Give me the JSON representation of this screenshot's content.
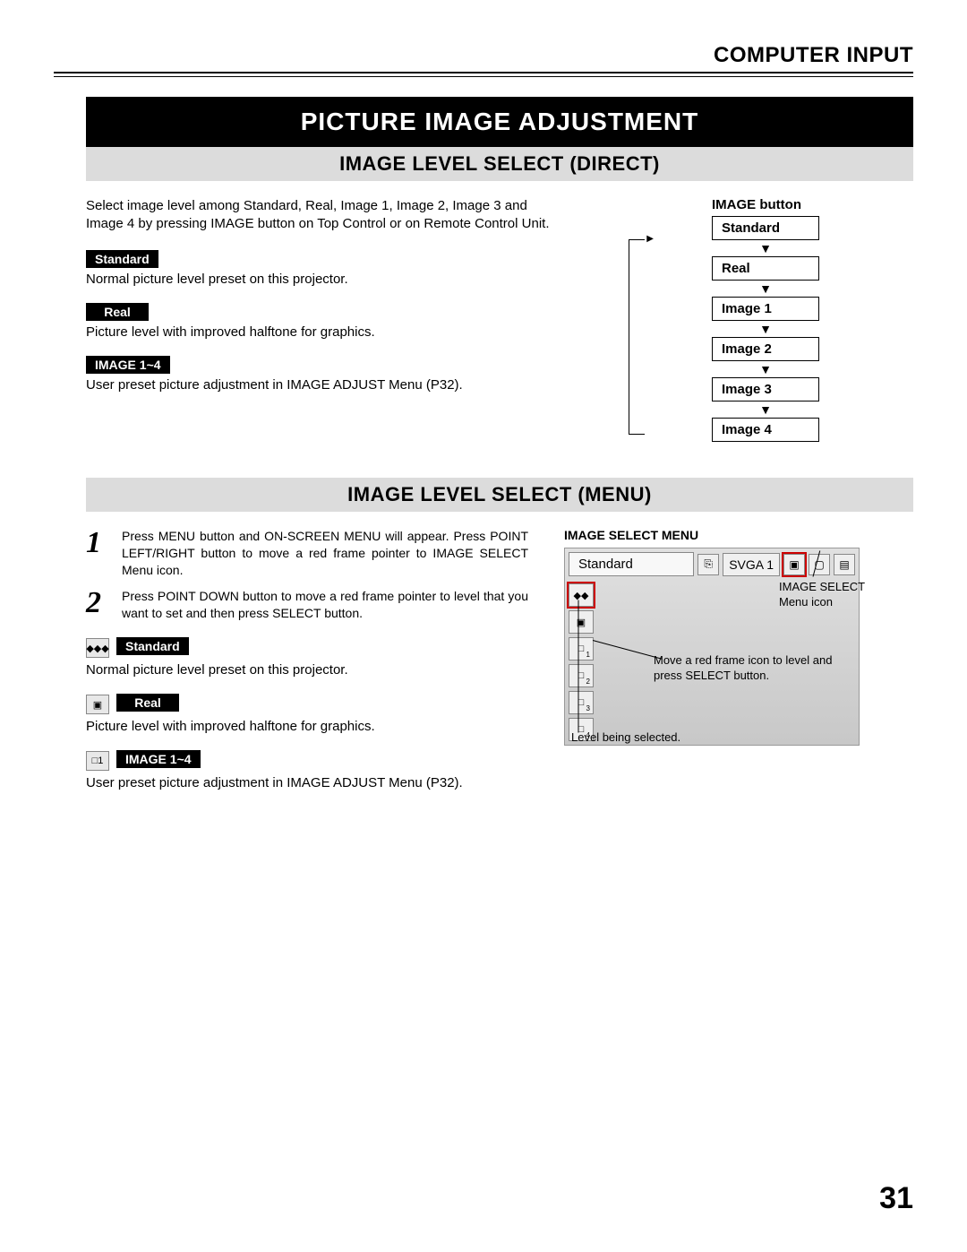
{
  "header": {
    "input": "COMPUTER INPUT"
  },
  "section": {
    "title": "PICTURE IMAGE ADJUSTMENT"
  },
  "direct": {
    "heading": "IMAGE LEVEL SELECT (DIRECT)",
    "intro": "Select image level among Standard, Real, Image 1, Image 2, Image 3 and Image 4 by pressing IMAGE button on Top Control or on Remote Control Unit.",
    "items": [
      {
        "label": "Standard",
        "desc": "Normal picture level preset on this projector."
      },
      {
        "label": "Real",
        "desc": "Picture level with improved halftone for graphics."
      },
      {
        "label": "IMAGE 1~4",
        "desc": "User preset picture adjustment in IMAGE ADJUST Menu (P32)."
      }
    ],
    "flow": {
      "title": "IMAGE button",
      "steps": [
        "Standard",
        "Real",
        "Image 1",
        "Image 2",
        "Image 3",
        "Image 4"
      ]
    }
  },
  "menu": {
    "heading": "IMAGE LEVEL SELECT (MENU)",
    "steps": [
      "Press MENU button and ON-SCREEN MENU will appear.  Press POINT LEFT/RIGHT button to move a red frame pointer to IMAGE SELECT Menu icon.",
      "Press POINT DOWN button to move a red frame pointer to level that you want to set and then press SELECT button."
    ],
    "items": [
      {
        "label": "Standard",
        "desc": "Normal picture level preset on this projector.",
        "icon": "◆◆◆"
      },
      {
        "label": "Real",
        "desc": "Picture level with improved halftone for graphics.",
        "icon": "▣"
      },
      {
        "label": "IMAGE 1~4",
        "desc": "User preset picture adjustment in IMAGE ADJUST Menu (P32).",
        "icon": "□1"
      }
    ],
    "osd": {
      "title": "IMAGE SELECT MENU",
      "current": "Standard",
      "svga": "SVGA 1",
      "side_items": [
        "◆◆",
        "▣",
        "□",
        "□",
        "□",
        "□"
      ],
      "side_subs": [
        "",
        "",
        "1",
        "2",
        "3",
        "4"
      ]
    },
    "callouts": {
      "icon": "IMAGE SELECT\nMenu icon",
      "move": "Move a red frame icon to level and press SELECT button.",
      "level": "Level being selected."
    }
  },
  "page_number": "31"
}
